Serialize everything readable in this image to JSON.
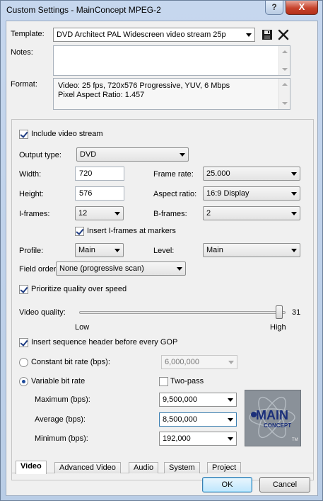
{
  "window": {
    "title": "Custom Settings - MainConcept MPEG-2",
    "help_label": "?",
    "close_label": "X"
  },
  "template": {
    "label": "Template:",
    "value": "DVD Architect PAL Widescreen video stream 25p"
  },
  "notes": {
    "label": "Notes:",
    "value": ""
  },
  "format": {
    "label": "Format:",
    "line1": "Video: 25 fps, 720x576 Progressive, YUV, 6 Mbps",
    "line2": "Pixel Aspect Ratio: 1.457"
  },
  "video": {
    "include_label": "Include video stream",
    "include_checked": true,
    "output_type_label": "Output type:",
    "output_type": "DVD",
    "width_label": "Width:",
    "width": "720",
    "height_label": "Height:",
    "height": "576",
    "frame_rate_label": "Frame rate:",
    "frame_rate": "25.000",
    "aspect_label": "Aspect ratio:",
    "aspect": "16:9 Display",
    "iframes_label": "I-frames:",
    "iframes": "12",
    "bframes_label": "B-frames:",
    "bframes": "2",
    "insert_iframes_label": "Insert I-frames at markers",
    "insert_iframes_checked": true,
    "profile_label": "Profile:",
    "profile": "Main",
    "level_label": "Level:",
    "level": "Main",
    "field_order_label": "Field order:",
    "field_order": "None (progressive scan)",
    "prioritize_label": "Prioritize quality over speed",
    "prioritize_checked": true,
    "quality_label": "Video quality:",
    "quality_value": "31",
    "quality_low": "Low",
    "quality_high": "High",
    "quality_fraction": 0.97,
    "seq_header_label": "Insert sequence header before every GOP",
    "seq_header_checked": true,
    "cbr_label": "Constant bit rate (bps):",
    "cbr_value": "6,000,000",
    "vbr_label": "Variable bit rate",
    "vbr_selected": true,
    "two_pass_label": "Two-pass",
    "two_pass_checked": false,
    "max_label": "Maximum (bps):",
    "max_value": "9,500,000",
    "avg_label": "Average (bps):",
    "avg_value": "8,500,000",
    "min_label": "Minimum (bps):",
    "min_value": "192,000"
  },
  "logo": {
    "text1": "MAIN",
    "text2": "CONCEPT",
    "tm": "TM"
  },
  "tabs": [
    "Video",
    "Advanced Video",
    "Audio",
    "System",
    "Project"
  ],
  "buttons": {
    "ok": "OK",
    "cancel": "Cancel"
  },
  "colors": {
    "accent": "#1d3b82",
    "logo_bg": "#8a9199",
    "close": "#c7432c"
  }
}
